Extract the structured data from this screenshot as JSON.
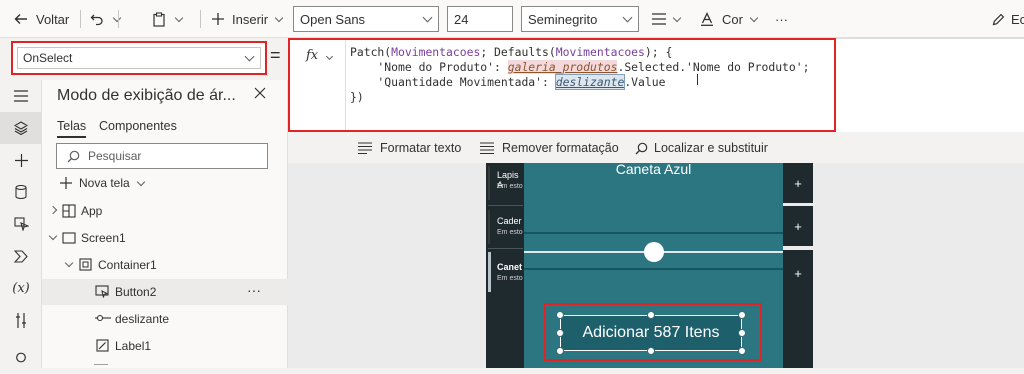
{
  "toolbar": {
    "back_label": "Voltar",
    "insert_label": "Inserir",
    "font_family": "Open Sans",
    "font_size": "24",
    "font_weight": "Seminegrito",
    "color_label": "Cor",
    "more_label": "···",
    "edit_label": "Ec"
  },
  "property": {
    "selected": "OnSelect"
  },
  "formula": {
    "fx_label": "fx",
    "line1_pre": "Patch(",
    "line1_coll1": "Movimentacoes",
    "line1_mid": "; Defaults(",
    "line1_coll2": "Movimentacoes",
    "line1_post": "); {",
    "line2_key": "    'Nome do Produto': ",
    "line2_ctrl": "galeria_produtos",
    "line2_prop": ".Selected.'Nome do Produto';",
    "line3_key": "    'Quantidade Movimentada': ",
    "line3_ctrl": "deslizante",
    "line3_prop": ".Value",
    "line4": "})"
  },
  "format_bar": {
    "format_text": "Formatar texto",
    "remove_format": "Remover formatação",
    "find_replace": "Localizar e substituir"
  },
  "tree_view": {
    "title": "Modo de exibição de ár...",
    "tab_screens": "Telas",
    "tab_components": "Componentes",
    "search_placeholder": "Pesquisar",
    "new_screen": "Nova tela",
    "items": [
      {
        "label": "App",
        "icon": "app-icon"
      },
      {
        "label": "Screen1",
        "icon": "screen-icon"
      },
      {
        "label": "Container1",
        "icon": "container-icon"
      },
      {
        "label": "Button2",
        "icon": "button-icon"
      },
      {
        "label": "deslizante",
        "icon": "slider-icon"
      },
      {
        "label": "Label1",
        "icon": "label-icon"
      }
    ],
    "more_label": "···"
  },
  "canvas": {
    "product_title": "Caneta Azul",
    "gallery_items": [
      {
        "title": "Lapis A",
        "subtitle": "Em esto"
      },
      {
        "title": "Cader",
        "subtitle": "Em esto"
      },
      {
        "title": "Canet",
        "subtitle": "Em esto"
      }
    ],
    "plus_label": "+",
    "button_label": "Adicionar 587 Itens",
    "slider_value": 0.5
  },
  "colors": {
    "highlight_red": "#e02424",
    "screen_teal": "#2c7682",
    "button_teal": "#1d5f6b",
    "dark_gallery": "#1f2a2f"
  }
}
